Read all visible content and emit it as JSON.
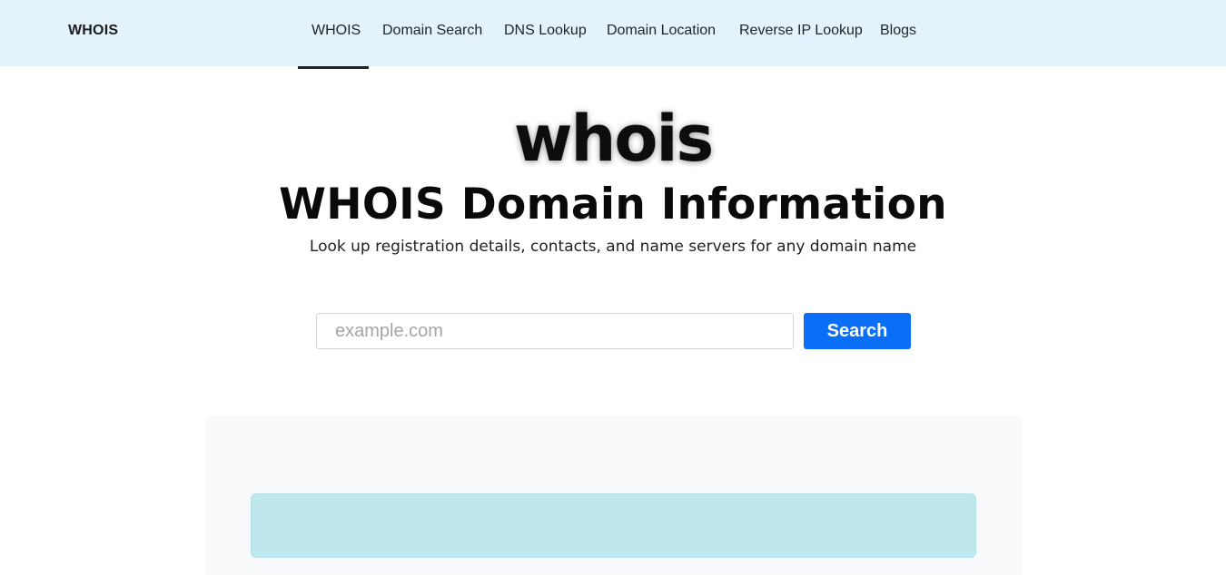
{
  "header": {
    "brand": "WHOIS",
    "nav": [
      {
        "label": "WHOIS",
        "active": true
      },
      {
        "label": "Domain Search",
        "active": false
      },
      {
        "label": "DNS Lookup",
        "active": false
      },
      {
        "label": "Domain Location",
        "active": false
      },
      {
        "label": "Reverse IP Lookup",
        "active": false
      },
      {
        "label": "Blogs",
        "active": false
      }
    ]
  },
  "hero": {
    "logo_text": "whois",
    "title": "WHOIS Domain Information",
    "subtitle": "Look up registration details, contacts, and name servers for any domain name"
  },
  "search": {
    "value": "",
    "placeholder": "example.com",
    "button_label": "Search"
  },
  "colors": {
    "header_bg": "#e4f2fc",
    "accent": "#0b6ef7",
    "result_bar": "#bfe8ee"
  }
}
